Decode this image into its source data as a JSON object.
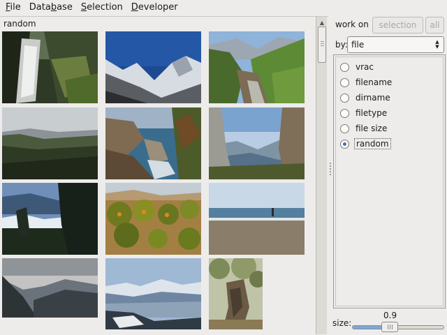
{
  "menubar": {
    "items": [
      {
        "pre": "",
        "mn": "F",
        "post": "ile"
      },
      {
        "pre": "Data",
        "mn": "b",
        "post": "ase"
      },
      {
        "pre": "",
        "mn": "S",
        "post": "election"
      },
      {
        "pre": "",
        "mn": "D",
        "post": "eveloper"
      }
    ]
  },
  "grid": {
    "title": "random",
    "thumbnails": [
      {
        "name": "waterfall-cliff"
      },
      {
        "name": "snowy-mountains"
      },
      {
        "name": "mountain-valley-stream"
      },
      {
        "name": "coastal-hills"
      },
      {
        "name": "rocky-coast-sea"
      },
      {
        "name": "cliff-valley-view"
      },
      {
        "name": "sea-of-clouds-tree"
      },
      {
        "name": "orange-grove"
      },
      {
        "name": "beach-walker"
      },
      {
        "name": "mountain-sunset-ridge"
      },
      {
        "name": "snowy-peaks-haze"
      },
      {
        "name": "olive-tree-trunk"
      }
    ]
  },
  "sidepanel": {
    "workon_label": "work on",
    "btn_selection": "selection",
    "btn_all": "all",
    "by_label": "by:",
    "by_value": "file",
    "options": [
      "vrac",
      "filename",
      "dirname",
      "filetype",
      "file size",
      "random"
    ],
    "selected_option": "random",
    "size_label": "size:",
    "size_value": "0.9"
  },
  "icons": {
    "scroll_up": "scroll-up-arrow-icon",
    "combo": "combo-arrows-icon"
  }
}
